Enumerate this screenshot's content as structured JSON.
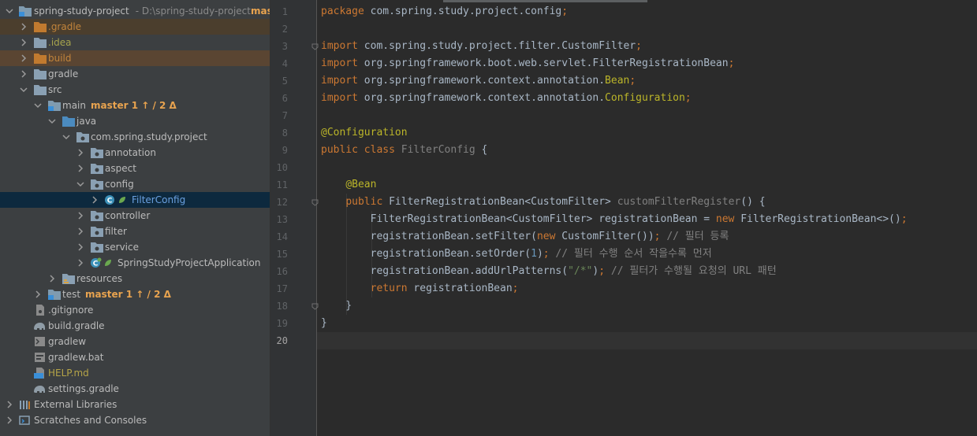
{
  "tree": {
    "project": {
      "name": "spring-study-project",
      "path": "- D:\\spring-study-project",
      "branch": "mast"
    },
    "items": [
      {
        "id": "gradle-hidden",
        "label": ".gradle"
      },
      {
        "id": "idea",
        "label": ".idea"
      },
      {
        "id": "build",
        "label": "build"
      },
      {
        "id": "gradle",
        "label": "gradle"
      },
      {
        "id": "src",
        "label": "src"
      },
      {
        "id": "main",
        "label": "main",
        "vcs": "master 1 ↑ / 2 Δ"
      },
      {
        "id": "java",
        "label": "java"
      },
      {
        "id": "package",
        "label": "com.spring.study.project"
      },
      {
        "id": "annotation",
        "label": "annotation"
      },
      {
        "id": "aspect",
        "label": "aspect"
      },
      {
        "id": "config",
        "label": "config"
      },
      {
        "id": "filterconfig",
        "label": "FilterConfig"
      },
      {
        "id": "controller",
        "label": "controller"
      },
      {
        "id": "filter",
        "label": "filter"
      },
      {
        "id": "service",
        "label": "service"
      },
      {
        "id": "app",
        "label": "SpringStudyProjectApplication"
      },
      {
        "id": "resources",
        "label": "resources"
      },
      {
        "id": "test",
        "label": "test",
        "vcs": "master 1 ↑ / 2 Δ"
      },
      {
        "id": "gitignore",
        "label": ".gitignore"
      },
      {
        "id": "build-gradle",
        "label": "build.gradle"
      },
      {
        "id": "gradlew",
        "label": "gradlew"
      },
      {
        "id": "gradlew-bat",
        "label": "gradlew.bat"
      },
      {
        "id": "help",
        "label": "HELP.md"
      },
      {
        "id": "settings-gradle",
        "label": "settings.gradle"
      },
      {
        "id": "ext-libs",
        "label": "External Libraries"
      },
      {
        "id": "scratches",
        "label": "Scratches and Consoles"
      }
    ]
  },
  "editor": {
    "current_line": 20,
    "lines": [
      [
        [
          "kw",
          "package "
        ],
        [
          "t",
          "com.spring.study.project.config"
        ],
        [
          "kw",
          ";"
        ]
      ],
      [],
      [
        [
          "kw",
          "import "
        ],
        [
          "t",
          "com.spring.study.project.filter.CustomFilter"
        ],
        [
          "kw",
          ";"
        ]
      ],
      [
        [
          "kw",
          "import "
        ],
        [
          "t",
          "org.springframework.boot.web.servlet.FilterRegistrationBean"
        ],
        [
          "kw",
          ";"
        ]
      ],
      [
        [
          "kw",
          "import "
        ],
        [
          "t",
          "org.springframework.context.annotation."
        ],
        [
          "an",
          "Bean"
        ],
        [
          "kw",
          ";"
        ]
      ],
      [
        [
          "kw",
          "import "
        ],
        [
          "t",
          "org.springframework.context.annotation."
        ],
        [
          "an",
          "Configuration"
        ],
        [
          "kw",
          ";"
        ]
      ],
      [],
      [
        [
          "an",
          "@Configuration"
        ]
      ],
      [
        [
          "kw",
          "public class "
        ],
        [
          "gray",
          "FilterConfig "
        ],
        [
          "t",
          "{"
        ]
      ],
      [],
      [
        [
          "t",
          "    "
        ],
        [
          "an",
          "@Bean"
        ]
      ],
      [
        [
          "t",
          "    "
        ],
        [
          "kw",
          "public "
        ],
        [
          "t",
          "FilterRegistrationBean<CustomFilter> "
        ],
        [
          "gray",
          "customFilterRegister"
        ],
        [
          "t",
          "() {"
        ]
      ],
      [
        [
          "t",
          "        FilterRegistrationBean<CustomFilter> registrationBean = "
        ],
        [
          "kw",
          "new "
        ],
        [
          "t",
          "FilterRegistrationBean<>()"
        ],
        [
          "kw",
          ";"
        ]
      ],
      [
        [
          "t",
          "        registrationBean.setFilter("
        ],
        [
          "kw",
          "new "
        ],
        [
          "t",
          "CustomFilter())"
        ],
        [
          "kw",
          "; "
        ],
        [
          "cm",
          "// 필터 등록"
        ]
      ],
      [
        [
          "t",
          "        registrationBean.setOrder("
        ],
        [
          "nm",
          "1"
        ],
        [
          "t",
          ")"
        ],
        [
          "kw",
          "; "
        ],
        [
          "cm",
          "// 필터 수행 순서 작을수록 먼저"
        ]
      ],
      [
        [
          "t",
          "        registrationBean.addUrlPatterns("
        ],
        [
          "st",
          "\"/*\""
        ],
        [
          "t",
          ")"
        ],
        [
          "kw",
          "; "
        ],
        [
          "cm",
          "// 필터가 수행될 요청의 URL 패턴"
        ]
      ],
      [
        [
          "t",
          "        "
        ],
        [
          "kw",
          "return "
        ],
        [
          "t",
          "registrationBean"
        ],
        [
          "kw",
          ";"
        ]
      ],
      [
        [
          "t",
          "    }"
        ]
      ],
      [
        [
          "t",
          "}"
        ]
      ],
      []
    ]
  }
}
